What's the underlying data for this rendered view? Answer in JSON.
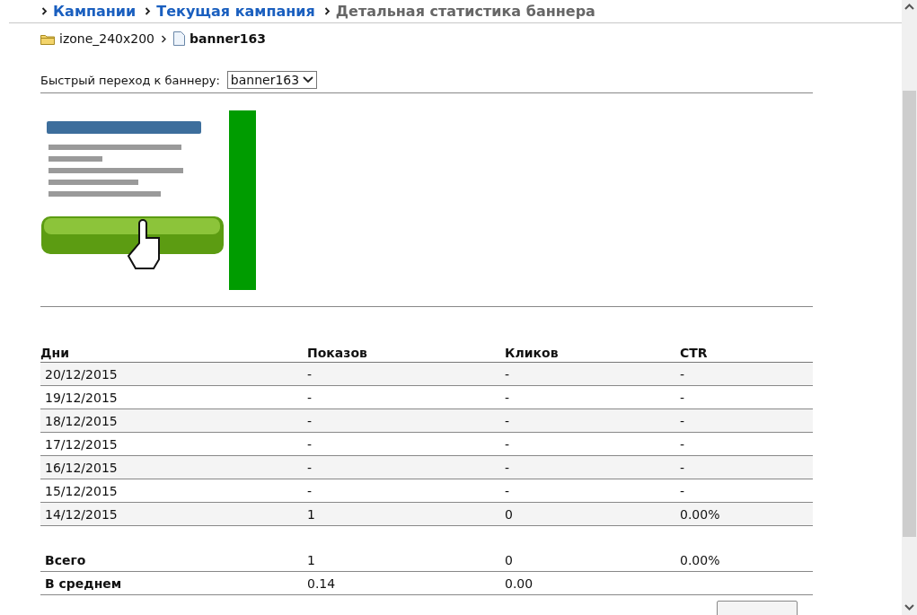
{
  "breadcrumbs": [
    {
      "label": "Кампании",
      "kind": "link"
    },
    {
      "label": "Текущая кампания",
      "kind": "link"
    },
    {
      "label": "Детальная статистика баннера",
      "kind": "current"
    }
  ],
  "path": [
    {
      "label": "izone_240x200",
      "kind": "folder"
    },
    {
      "label": "banner163",
      "kind": "file"
    }
  ],
  "quick_jump": {
    "label": "Быстрый переход к баннеру:",
    "value": "banner163"
  },
  "table": {
    "columns": [
      "Дни",
      "Показов",
      "Кликов",
      "CTR"
    ],
    "rows": [
      [
        "20/12/2015",
        "-",
        "-",
        "-"
      ],
      [
        "19/12/2015",
        "-",
        "-",
        "-"
      ],
      [
        "18/12/2015",
        "-",
        "-",
        "-"
      ],
      [
        "17/12/2015",
        "-",
        "-",
        "-"
      ],
      [
        "16/12/2015",
        "-",
        "-",
        "-"
      ],
      [
        "15/12/2015",
        "-",
        "-",
        "-"
      ],
      [
        "14/12/2015",
        "1",
        "0",
        "0.00%"
      ]
    ],
    "summary": [
      [
        "Всего",
        "1",
        "0",
        "0.00%"
      ],
      [
        "В среднем",
        "0.14",
        "0.00"
      ]
    ]
  }
}
